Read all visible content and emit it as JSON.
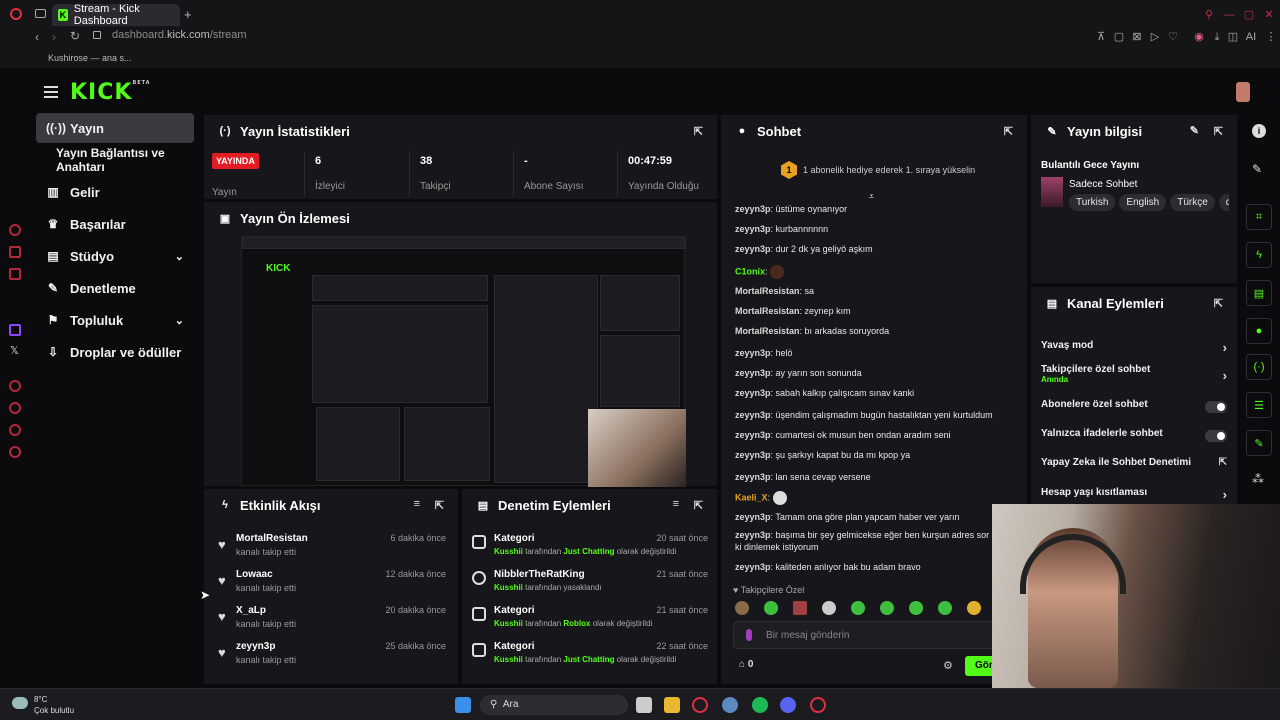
{
  "browser": {
    "tab_title": "Stream - Kick Dashboard",
    "url_prefix": "dashboard.",
    "url_domain": "kick.com",
    "url_path": "/stream",
    "bookmark": "Kushirose — ana s..."
  },
  "brand": {
    "logo": "KICK",
    "beta": "BETA",
    "accent": "#53fc18",
    "live_red": "#e31b23"
  },
  "sidebar": {
    "items": [
      {
        "label": "Yayın",
        "icon": "broadcast-icon"
      },
      {
        "label": "Yayın Bağlantısı ve Anahtarı"
      },
      {
        "label": "Gelir",
        "icon": "chart-icon"
      },
      {
        "label": "Başarılar",
        "icon": "trophy-icon"
      },
      {
        "label": "Stüdyo",
        "icon": "studio-icon"
      },
      {
        "label": "Denetleme",
        "icon": "wrench-icon"
      },
      {
        "label": "Topluluk",
        "icon": "community-icon"
      },
      {
        "label": "Droplar ve ödüller",
        "icon": "drops-icon"
      }
    ]
  },
  "stats": {
    "title": "Yayın İstatistikleri",
    "live_badge": "YAYINDA",
    "live_label": "Yayın",
    "viewers": "6",
    "viewers_label": "İzleyici",
    "followers": "38",
    "followers_label": "Takipçi",
    "subs": "-",
    "subs_label": "Abone Sayısı",
    "uptime": "00:47:59",
    "uptime_label": "Yayında Olduğu"
  },
  "preview": {
    "title": "Yayın Ön İzlemesi"
  },
  "activity": {
    "title": "Etkinlik Akışı",
    "items": [
      {
        "name": "MortalResistan",
        "sub": "kanalı takip etti",
        "time": "6 dakika önce"
      },
      {
        "name": "Lowaac",
        "sub": "kanalı takip etti",
        "time": "12 dakika önce"
      },
      {
        "name": "X_aLp",
        "sub": "kanalı takip etti",
        "time": "20 dakika önce"
      },
      {
        "name": "zeyyn3p",
        "sub": "kanalı takip etti",
        "time": "25 dakika önce"
      }
    ]
  },
  "moderation": {
    "title": "Denetim Eylemleri",
    "items": [
      {
        "name": "Kategori",
        "by": "Kusshii",
        "mid": " tarafından ",
        "target": "Just Chatting",
        "tail": " olarak değiştirildi",
        "time": "20 saat önce",
        "icon": "category-icon"
      },
      {
        "name": "NibblerTheRatKing",
        "by": "Kusshii",
        "mid": " tarafından yasaklandı",
        "target": "",
        "tail": "",
        "time": "21 saat önce",
        "icon": "ban-icon"
      },
      {
        "name": "Kategori",
        "by": "Kusshii",
        "mid": " tarafından ",
        "target": "Roblox",
        "tail": " olarak değiştirildi",
        "time": "21 saat önce",
        "icon": "category-icon"
      },
      {
        "name": "Kategori",
        "by": "Kusshii",
        "mid": " tarafından ",
        "target": "Just Chatting",
        "tail": " olarak değiştirildi",
        "time": "22 saat önce",
        "icon": "category-icon"
      }
    ]
  },
  "chat": {
    "title": "Sohbet",
    "pinned": "1 abonelik hediye ederek 1. sıraya yükselin",
    "pinned_rank": "1",
    "messages": [
      {
        "user": "zeyyn3p",
        "text": "üstüme oynanıyor"
      },
      {
        "user": "zeyyn3p",
        "text": "kurbannnnnn"
      },
      {
        "user": "zeyyn3p",
        "text": "dur 2 dk ya geliyö aşkım"
      },
      {
        "user": "C1onix",
        "text": ""
      },
      {
        "user": "MortalResistan",
        "text": "sa"
      },
      {
        "user": "MortalResistan",
        "text": "zeynep kım"
      },
      {
        "user": "MortalResistan",
        "text": "bı arkadas soruyorda"
      },
      {
        "user": "zeyyn3p",
        "text": "helö"
      },
      {
        "user": "zeyyn3p",
        "text": "ay yarın son sonunda"
      },
      {
        "user": "zeyyn3p",
        "text": "sabah kalkıp çalışıcam sınav kanki"
      },
      {
        "user": "zeyyn3p",
        "text": "üşendim çalışmadım bugün hastalıktan yeni kurtuldum"
      },
      {
        "user": "zeyyn3p",
        "text": "cumartesi ok musun ben ondan aradım seni"
      },
      {
        "user": "zeyyn3p",
        "text": "şu şarkıyı kapat bu da mı kpop ya"
      },
      {
        "user": "zeyyn3p",
        "text": "lan sena cevap versene"
      },
      {
        "user": "Kaeli_X",
        "text": ""
      },
      {
        "user": "zeyyn3p",
        "text": "Tamam ona göre plan yapcam haber ver yarın"
      },
      {
        "user": "zeyyn3p",
        "text": "başıma bir şey gelmicekse eğer ben kurşun adres sor"
      },
      {
        "user": "",
        "text": "ki dinlemek istiyorum"
      },
      {
        "user": "zeyyn3p",
        "text": "kaliteden anlıyor bak bu adam bravo"
      }
    ],
    "emote_header": "Takipçilere Özel",
    "input_placeholder": "Bir mesaj gönderin",
    "points": "0",
    "send_label": "Gön"
  },
  "stream_info": {
    "title": "Yayın bilgisi",
    "stream_title": "Bulantılı Gece Yayını",
    "category": "Sadece Sohbet",
    "tags": [
      "Turkish",
      "English",
      "Türkçe",
      "cl"
    ]
  },
  "channel_actions": {
    "title": "Kanal Eylemleri",
    "rows": [
      {
        "label": "Yavaş mod",
        "kind": "chevron"
      },
      {
        "label": "Takipçilere özel sohbet",
        "sub": "Anında",
        "kind": "chevron"
      },
      {
        "label": "Abonelere özel sohbet",
        "kind": "toggle"
      },
      {
        "label": "Yalnızca ifadelerle sohbet",
        "kind": "toggle"
      },
      {
        "label": "Yapay Zeka ile Sohbet Denetimi",
        "kind": "external"
      },
      {
        "label": "Hesap yaşı kısıtlaması",
        "kind": "chevron"
      }
    ]
  },
  "taskbar": {
    "weather_temp": "8°C",
    "weather_desc": "Çok bulutlu",
    "search": "Ara"
  }
}
